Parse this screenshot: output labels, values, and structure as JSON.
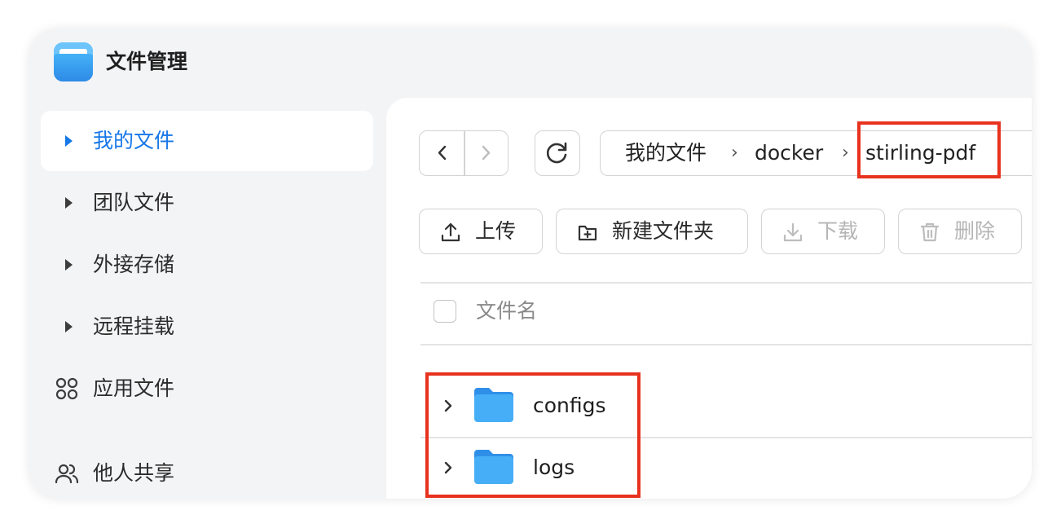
{
  "app": {
    "title": "文件管理"
  },
  "sidebar": {
    "items": [
      {
        "label": "我的文件",
        "icon": "caret-right-icon",
        "active": true
      },
      {
        "label": "团队文件",
        "icon": "caret-right-icon"
      },
      {
        "label": "外接存储",
        "icon": "caret-right-icon"
      },
      {
        "label": "远程挂载",
        "icon": "caret-right-icon"
      },
      {
        "label": "应用文件",
        "icon": "apps-grid-icon"
      },
      {
        "label": "他人共享",
        "icon": "users-icon"
      }
    ]
  },
  "breadcrumb": [
    "我的文件",
    "docker",
    "stirling-pdf"
  ],
  "toolbar": {
    "upload": "上传",
    "new_folder": "新建文件夹",
    "download": "下载",
    "delete": "删除"
  },
  "table": {
    "header": "文件名",
    "rows": [
      {
        "name": "configs",
        "icon": "folder-icon"
      },
      {
        "name": "logs",
        "icon": "folder-icon"
      }
    ]
  },
  "colors": {
    "accent": "#1677e8",
    "folder": "#3a9ff2",
    "highlight": "#e8321e",
    "disabled_text": "#b5b5b5"
  }
}
